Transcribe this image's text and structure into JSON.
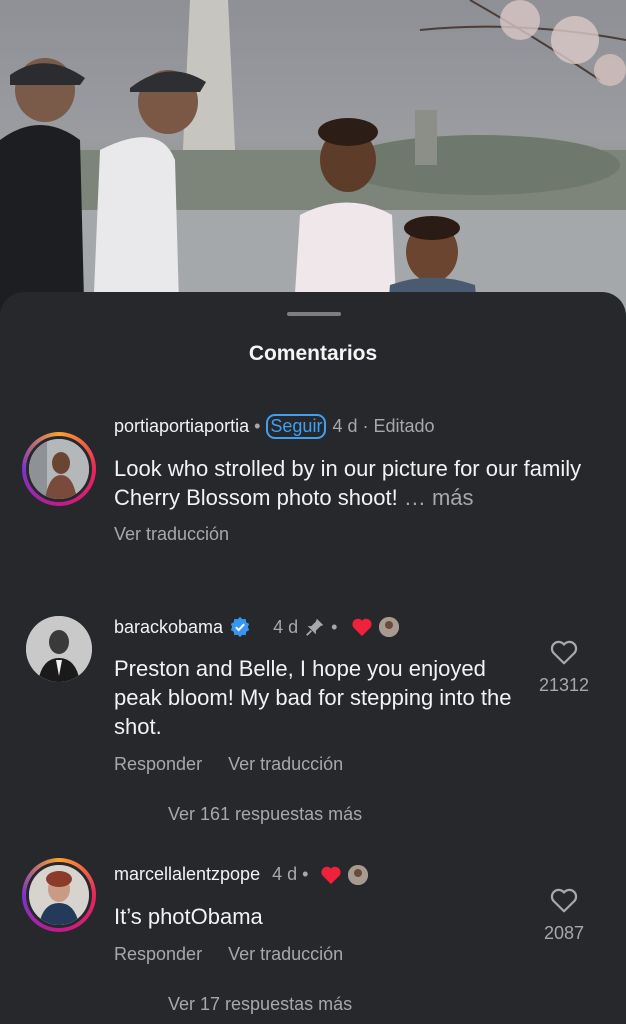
{
  "sheet": {
    "title": "Comentarios"
  },
  "comments": [
    {
      "username": "portiaportiaportia",
      "follow_label": "Seguir",
      "time": "4 d",
      "edited": "Editado",
      "text": "Look who strolled by in our picture for our family Cherry Blossom photo shoot!",
      "more": "… más",
      "translate": "Ver traducción"
    },
    {
      "username": "barackobama",
      "time": "4 d",
      "text": "Preston and Belle, I hope you enjoyed peak bloom! My bad for stepping into the shot.",
      "reply": "Responder",
      "translate": "Ver traducción",
      "likes": "21312",
      "more_replies": "Ver 161 respuestas más"
    },
    {
      "username": "marcellalentzpope",
      "time": "4 d",
      "text": "It’s photObama",
      "reply": "Responder",
      "translate": "Ver traducción",
      "likes": "2087",
      "more_replies": "Ver 17 respuestas más"
    }
  ],
  "icons": {
    "verified": "verified-badge-icon",
    "pin": "pin-icon",
    "heart": "heart-outline-icon",
    "creator_heart": "heart-filled-icon"
  },
  "colors": {
    "background": "#26282c",
    "link": "#3ea0f5",
    "heart_red": "#f0213a"
  }
}
